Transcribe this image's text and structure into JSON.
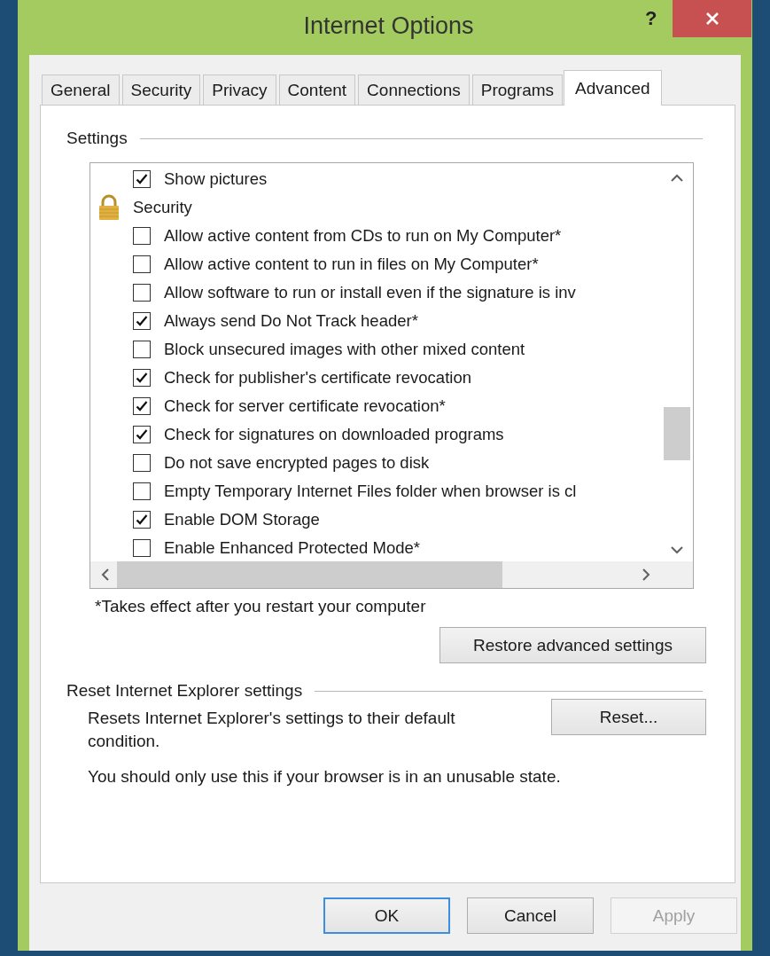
{
  "window": {
    "title": "Internet Options",
    "help": "?"
  },
  "tabs": [
    {
      "label": "General",
      "selected": false
    },
    {
      "label": "Security",
      "selected": false
    },
    {
      "label": "Privacy",
      "selected": false
    },
    {
      "label": "Content",
      "selected": false
    },
    {
      "label": "Connections",
      "selected": false
    },
    {
      "label": "Programs",
      "selected": false
    },
    {
      "label": "Advanced",
      "selected": true
    }
  ],
  "settings": {
    "title": "Settings",
    "items": [
      {
        "kind": "checkbox",
        "label": "Show pictures",
        "checked": true
      },
      {
        "kind": "category",
        "label": "Security",
        "children": [
          {
            "kind": "checkbox",
            "label": "Allow active content from CDs to run on My Computer*",
            "checked": false
          },
          {
            "kind": "checkbox",
            "label": "Allow active content to run in files on My Computer*",
            "checked": false
          },
          {
            "kind": "checkbox",
            "label": "Allow software to run or install even if the signature is inv",
            "checked": false
          },
          {
            "kind": "checkbox",
            "label": "Always send Do Not Track header*",
            "checked": true
          },
          {
            "kind": "checkbox",
            "label": "Block unsecured images with other mixed content",
            "checked": false
          },
          {
            "kind": "checkbox",
            "label": "Check for publisher's certificate revocation",
            "checked": true
          },
          {
            "kind": "checkbox",
            "label": "Check for server certificate revocation*",
            "checked": true
          },
          {
            "kind": "checkbox",
            "label": "Check for signatures on downloaded programs",
            "checked": true
          },
          {
            "kind": "checkbox",
            "label": "Do not save encrypted pages to disk",
            "checked": false
          },
          {
            "kind": "checkbox",
            "label": "Empty Temporary Internet Files folder when browser is cl",
            "checked": false
          },
          {
            "kind": "checkbox",
            "label": "Enable DOM Storage",
            "checked": true
          },
          {
            "kind": "checkbox",
            "label": "Enable Enhanced Protected Mode*",
            "checked": false
          }
        ]
      }
    ],
    "note": "*Takes effect after you restart your computer",
    "restore_button": "Restore advanced settings"
  },
  "reset": {
    "title": "Reset Internet Explorer settings",
    "description": "Resets Internet Explorer's settings to their default condition.",
    "button": "Reset...",
    "warning": "You should only use this if your browser is in an unusable state."
  },
  "buttons": [
    {
      "label": "OK",
      "default": true,
      "disabled": false
    },
    {
      "label": "Cancel",
      "default": false,
      "disabled": false
    },
    {
      "label": "Apply",
      "default": false,
      "disabled": true
    }
  ]
}
